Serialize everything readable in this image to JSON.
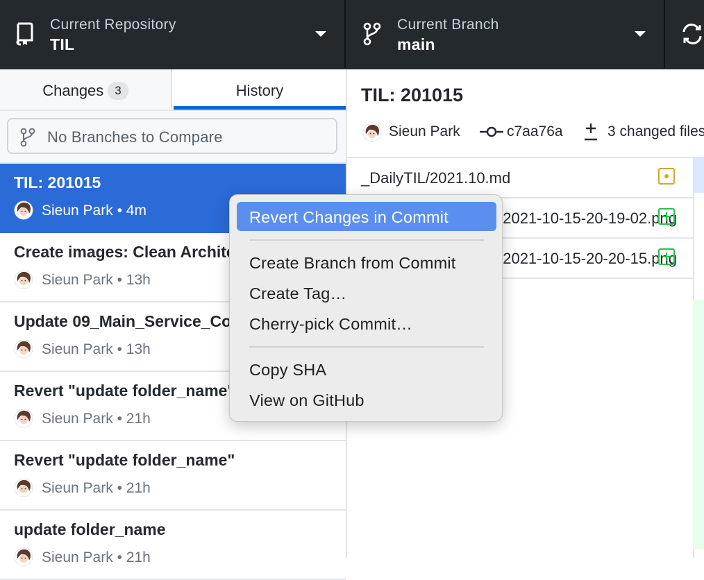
{
  "toolbar": {
    "repo_label": "Current Repository",
    "repo_value": "TIL",
    "branch_label": "Current Branch",
    "branch_value": "main",
    "repo_icon": "repo-icon",
    "branch_icon": "git-branch-icon",
    "fetch_icon": "sync-icon"
  },
  "sidebar": {
    "tabs": [
      {
        "label": "Changes",
        "badge": "3"
      },
      {
        "label": "History"
      }
    ],
    "compare_placeholder": "No Branches to Compare",
    "commits": [
      {
        "title": "TIL: 201015",
        "author": "Sieun Park",
        "time": "4m"
      },
      {
        "title": "Create images: Clean Architecture",
        "author": "Sieun Park",
        "time": "13h"
      },
      {
        "title": "Update 09_Main_Service_Component",
        "author": "Sieun Park",
        "time": "13h"
      },
      {
        "title": "Revert \"update folder_name\"",
        "author": "Sieun Park",
        "time": "21h"
      },
      {
        "title": "Revert \"update folder_name\"",
        "author": "Sieun Park",
        "time": "21h"
      },
      {
        "title": "update folder_name",
        "author": "Sieun Park",
        "time": "21h"
      }
    ],
    "separator": "•"
  },
  "detail": {
    "title": "TIL: 201015",
    "author": "Sieun Park",
    "sha": "c7aa76a",
    "changed": "3 changed files",
    "files": [
      {
        "name": "_DailyTIL/2021.10.md",
        "status": "modified"
      },
      {
        "name": "images/Screen Shot 2021-10-15-20-19-02.png",
        "status": "added"
      },
      {
        "name": "images/Screen Shot 2021-10-15-20-20-15.png",
        "status": "added"
      }
    ]
  },
  "context_menu": {
    "items": [
      "Revert Changes in Commit",
      "Create Branch from Commit",
      "Create Tag…",
      "Cherry-pick Commit…",
      "Copy SHA",
      "View on GitHub"
    ]
  },
  "colors": {
    "toolbar_bg": "#24292e",
    "selected_commit": "#2b6bd8",
    "menu_highlight": "#5a8ff0",
    "tab_underline": "#0366d6",
    "modified": "#d4a72c",
    "added": "#2cbe4e"
  }
}
